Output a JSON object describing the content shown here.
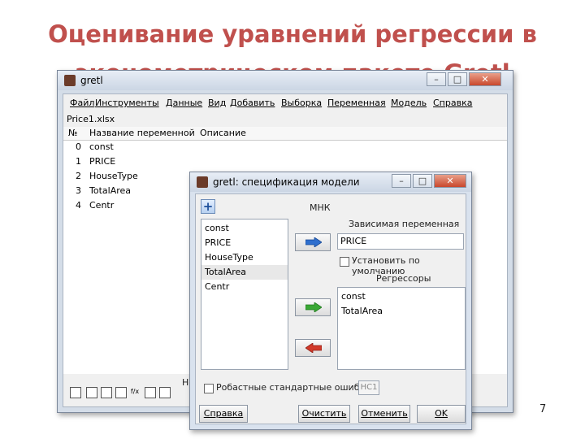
{
  "slide": {
    "title_line1": "Оценивание уравнений регрессии в",
    "title_line2": "эконометрическом пакете Gretl",
    "page_number": "7"
  },
  "main_window": {
    "title": "gretl",
    "menu": [
      "Файл",
      "Инструменты",
      "Данные",
      "Вид",
      "Добавить",
      "Выборка",
      "Переменная",
      "Модель",
      "Справка"
    ],
    "filename": "Price1.xlsx",
    "columns": {
      "num": "№",
      "name": "Название переменной",
      "desc": "Описание"
    },
    "variables": [
      {
        "id": "0",
        "name": "const"
      },
      {
        "id": "1",
        "name": "PRICE"
      },
      {
        "id": "2",
        "name": "HouseType"
      },
      {
        "id": "3",
        "name": "TotalArea"
      },
      {
        "id": "4",
        "name": "Centr"
      }
    ],
    "bottom_label": "Не"
  },
  "dialog": {
    "title": "gretl: спецификация модели",
    "method": "МНК",
    "available_vars": [
      "const",
      "PRICE",
      "HouseType",
      "TotalArea",
      "Centr"
    ],
    "dependent_label": "Зависимая переменная",
    "dependent_value": "PRICE",
    "default_checkbox_label": "Установить по умолчанию",
    "regressors_label": "Регрессоры",
    "regressors": [
      "const",
      "TotalArea"
    ],
    "robust_label": "Робастные стандартные ошибки",
    "robust_option": "HC1",
    "buttons": {
      "help": "Справка",
      "clear": "Очистить",
      "cancel": "Отменить",
      "ok": "OK"
    }
  },
  "colors": {
    "title": "#c0504d",
    "arrow_blue": "#2f6fce",
    "arrow_green": "#3aa835",
    "arrow_red": "#d23a2a"
  }
}
